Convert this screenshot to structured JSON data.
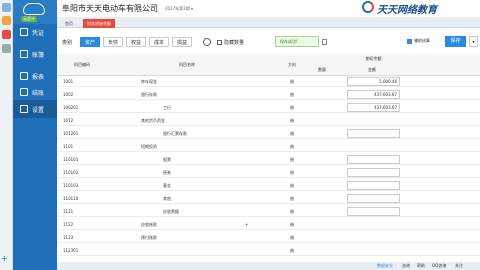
{
  "app": {
    "company": "阜阳市天天电动车有限公司",
    "period": "2017年第1期 ▾",
    "brand": "天天网络教育"
  },
  "sidebar": {
    "version": "云会计",
    "items": [
      {
        "label": "凭证",
        "icon": "voucher-icon"
      },
      {
        "label": "账簿",
        "icon": "ledger-icon"
      },
      {
        "label": "报表",
        "icon": "report-icon"
      },
      {
        "label": "结账",
        "icon": "closing-icon"
      },
      {
        "label": "设置",
        "icon": "settings-icon",
        "active": true
      }
    ]
  },
  "tabs": [
    {
      "label": "首页"
    },
    {
      "label": "财务初始余额",
      "active": true
    }
  ],
  "toolbar": {
    "label": "类别",
    "categories": [
      "资产",
      "负债",
      "权益",
      "成本",
      "损益"
    ],
    "hide_zero": "隐藏数量",
    "saved": "保存成功!",
    "assist": "辅助核算",
    "save": "保存",
    "more": "▾"
  },
  "table": {
    "headers": {
      "code": "科目编码",
      "name": "科目名称",
      "direction": "方向",
      "opening": "期初余额",
      "qty": "数量",
      "amount": "金额"
    },
    "rows": [
      {
        "code": "1001",
        "name": "库存现金",
        "dir": "借",
        "amount": "5,000.46"
      },
      {
        "code": "1002",
        "name": "银行存款",
        "dir": "借",
        "amount": "437,603.67"
      },
      {
        "code": "100201",
        "name": "工行",
        "dir": "借",
        "amount": "437,603.67",
        "box": true
      },
      {
        "code": "1012",
        "name": "其他货币资金",
        "dir": "借",
        "amount": ""
      },
      {
        "code": "101201",
        "name": "银行汇票存款",
        "dir": "借",
        "amount": "",
        "box": true
      },
      {
        "code": "1101",
        "name": "短期投资",
        "dir": "借",
        "amount": ""
      },
      {
        "code": "110101",
        "name": "股票",
        "dir": "借",
        "amount": "",
        "box": true
      },
      {
        "code": "110102",
        "name": "债券",
        "dir": "借",
        "amount": "",
        "box": true
      },
      {
        "code": "110103",
        "name": "基金",
        "dir": "借",
        "amount": "",
        "box": true
      },
      {
        "code": "110110",
        "name": "其他",
        "dir": "借",
        "amount": "",
        "box": true
      },
      {
        "code": "1121",
        "name": "应收票据",
        "dir": "借",
        "amount": "",
        "box": true
      },
      {
        "code": "1122",
        "name": "应收账款",
        "dir": "借",
        "amount": "",
        "plus": true
      },
      {
        "code": "1123",
        "name": "预付账款",
        "dir": "借",
        "amount": ""
      },
      {
        "code": "112301",
        "name": "",
        "dir": "借",
        "amount": ""
      }
    ]
  },
  "status": {
    "a": "数据安全",
    "b": "咨询",
    "c": "帮助",
    "d": "QQ咨询",
    "e": "关注"
  }
}
